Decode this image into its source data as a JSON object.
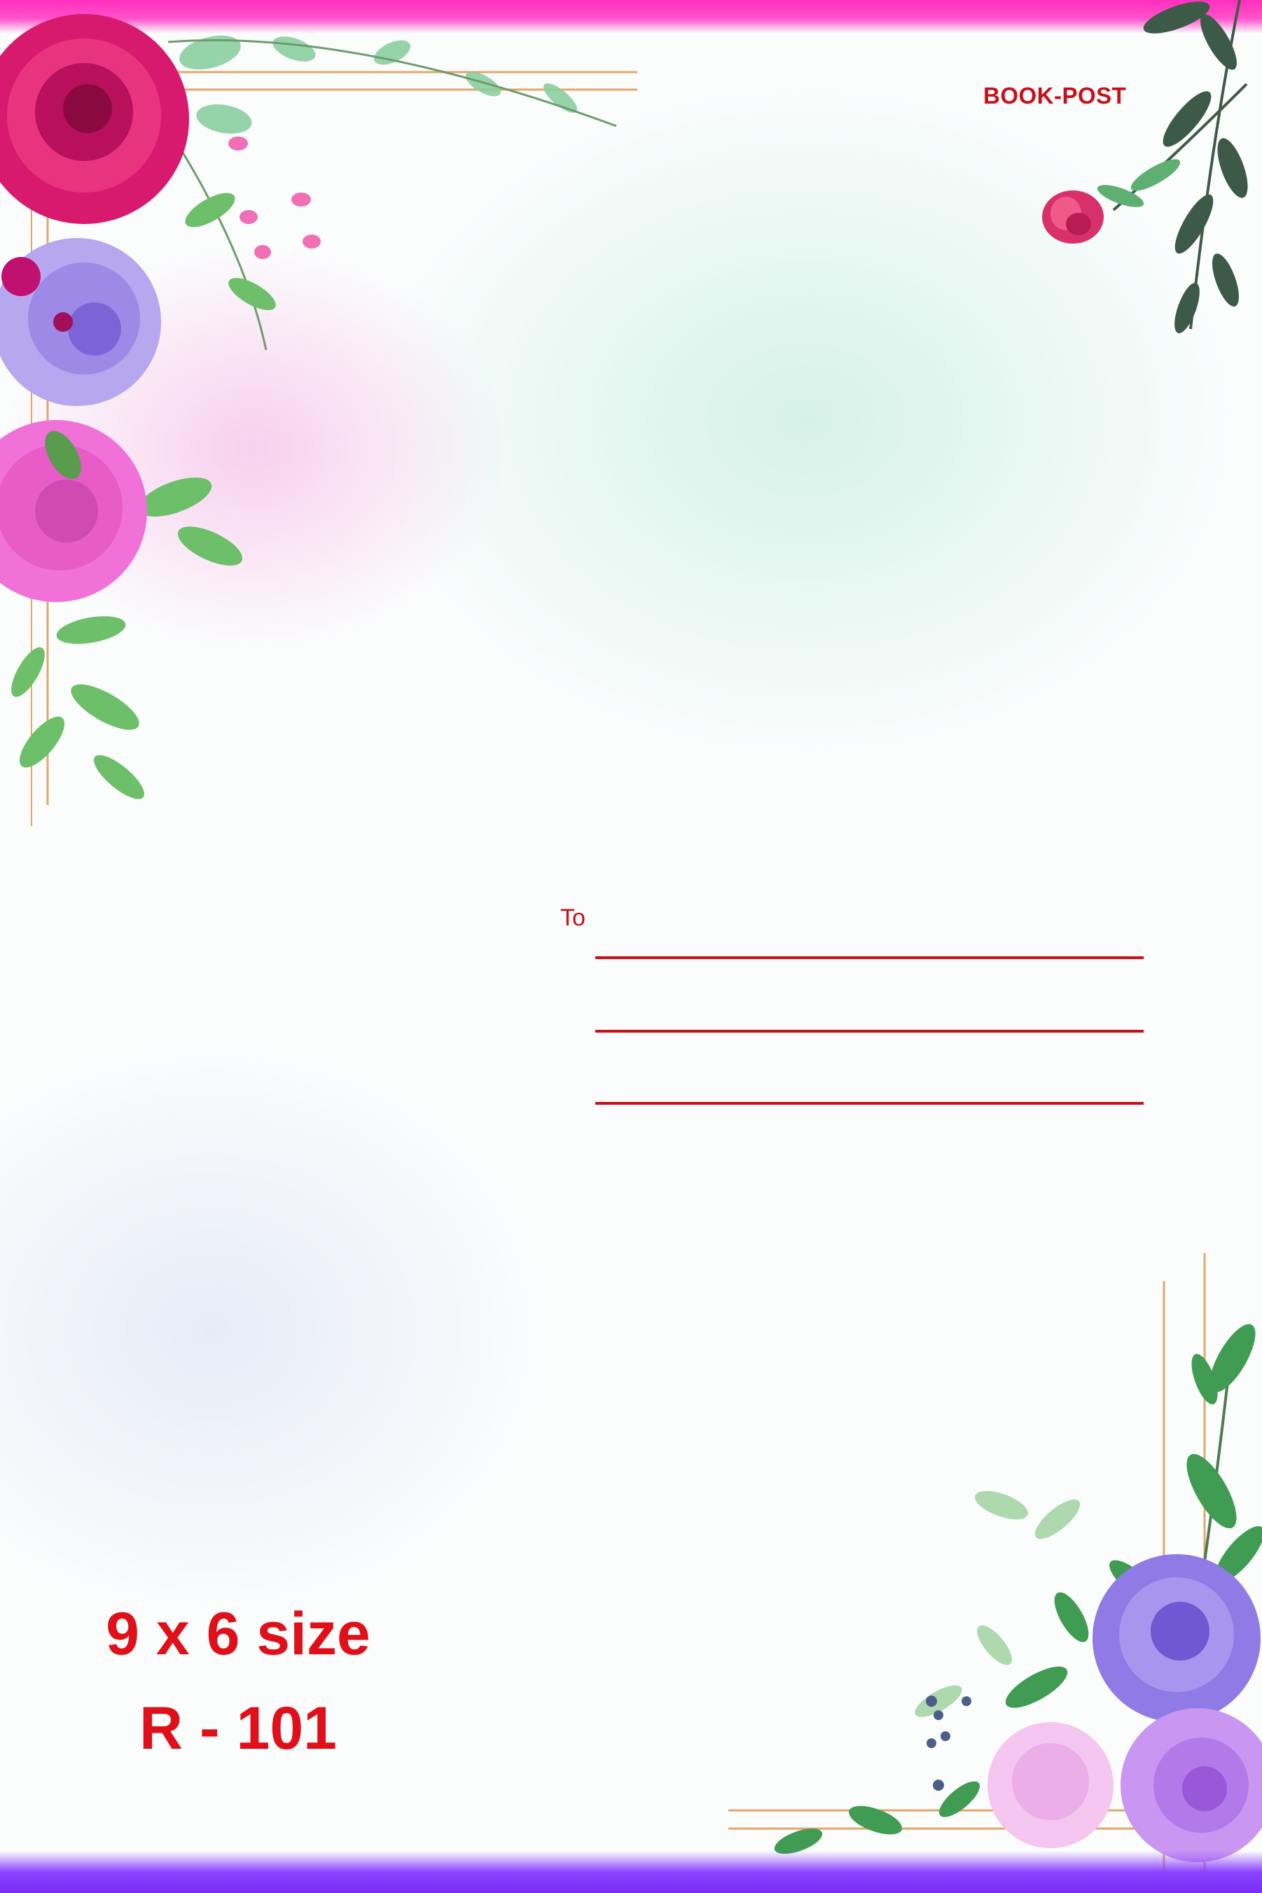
{
  "header": {
    "label": "BOOK-POST"
  },
  "address": {
    "to_label": "To"
  },
  "footer": {
    "size": "9 x 6 size",
    "code": "R - 101"
  },
  "colors": {
    "top_band": "#ff2fbd",
    "bottom_band": "#7a2cf5",
    "text_red": "#c8101a"
  }
}
